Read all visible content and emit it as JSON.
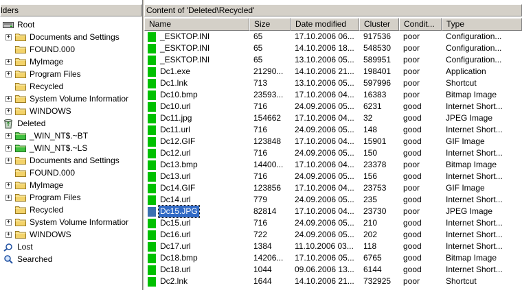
{
  "left_pane": {
    "title": "lders",
    "tree": [
      {
        "label": "Root",
        "icon": "drive-icon",
        "level": 0,
        "expander": "-"
      },
      {
        "label": "Documents and Settings",
        "icon": "folder-icon",
        "level": 1,
        "expander": "+"
      },
      {
        "label": "FOUND.000",
        "icon": "folder-icon",
        "level": 1,
        "expander": ""
      },
      {
        "label": "MyImage",
        "icon": "folder-icon",
        "level": 1,
        "expander": "+"
      },
      {
        "label": "Program Files",
        "icon": "folder-icon",
        "level": 1,
        "expander": "+"
      },
      {
        "label": "Recycled",
        "icon": "folder-icon",
        "level": 1,
        "expander": ""
      },
      {
        "label": "System Volume Informatior",
        "icon": "folder-icon",
        "level": 1,
        "expander": "+"
      },
      {
        "label": "WINDOWS",
        "icon": "folder-icon",
        "level": 1,
        "expander": "+"
      },
      {
        "label": "Deleted",
        "icon": "recycle-bin-icon",
        "level": 0,
        "expander": "-"
      },
      {
        "label": "_WIN_NT$.~BT",
        "icon": "green-folder-icon",
        "level": 1,
        "expander": "+"
      },
      {
        "label": "_WIN_NT$.~LS",
        "icon": "green-folder-icon",
        "level": 1,
        "expander": "+"
      },
      {
        "label": "Documents and Settings",
        "icon": "folder-icon",
        "level": 1,
        "expander": "+"
      },
      {
        "label": "FOUND.000",
        "icon": "folder-icon",
        "level": 1,
        "expander": ""
      },
      {
        "label": "MyImage",
        "icon": "folder-icon",
        "level": 1,
        "expander": "+"
      },
      {
        "label": "Program Files",
        "icon": "folder-icon",
        "level": 1,
        "expander": "+"
      },
      {
        "label": "Recycled",
        "icon": "folder-icon",
        "level": 1,
        "expander": ""
      },
      {
        "label": "System Volume Informatior",
        "icon": "folder-icon",
        "level": 1,
        "expander": "+"
      },
      {
        "label": "WINDOWS",
        "icon": "folder-icon",
        "level": 1,
        "expander": "+"
      },
      {
        "label": "Lost",
        "icon": "lost-search-icon",
        "level": 0,
        "expander": ""
      },
      {
        "label": "Searched",
        "icon": "search-icon",
        "level": 0,
        "expander": ""
      }
    ]
  },
  "right_pane": {
    "title": "Content of 'Deleted\\Recycled'",
    "columns": [
      "Name",
      "Size",
      "Date modified",
      "Cluster",
      "Condit...",
      "Type"
    ],
    "selected_index": 17,
    "rows": [
      [
        "_ESKTOP.INI",
        "65",
        "17.10.2006 06...",
        "917536",
        "poor",
        "Configuration..."
      ],
      [
        "_ESKTOP.INI",
        "65",
        "14.10.2006 18...",
        "548530",
        "poor",
        "Configuration..."
      ],
      [
        "_ESKTOP.INI",
        "65",
        "13.10.2006 05...",
        "589951",
        "poor",
        "Configuration..."
      ],
      [
        "Dc1.exe",
        "21290...",
        "14.10.2006 21...",
        "198401",
        "poor",
        "Application"
      ],
      [
        "Dc1.lnk",
        "713",
        "13.10.2006 05...",
        "597996",
        "poor",
        "Shortcut"
      ],
      [
        "Dc10.bmp",
        "23593...",
        "17.10.2006 04...",
        "16383",
        "poor",
        "Bitmap Image"
      ],
      [
        "Dc10.url",
        "716",
        "24.09.2006 05...",
        "6231",
        "good",
        "Internet Short..."
      ],
      [
        "Dc11.jpg",
        "154662",
        "17.10.2006 04...",
        "32",
        "good",
        "JPEG Image"
      ],
      [
        "Dc11.url",
        "716",
        "24.09.2006 05...",
        "148",
        "good",
        "Internet Short..."
      ],
      [
        "Dc12.GIF",
        "123848",
        "17.10.2006 04...",
        "15901",
        "good",
        "GIF Image"
      ],
      [
        "Dc12.url",
        "716",
        "24.09.2006 05...",
        "150",
        "good",
        "Internet Short..."
      ],
      [
        "Dc13.bmp",
        "14400...",
        "17.10.2006 04...",
        "23378",
        "poor",
        "Bitmap Image"
      ],
      [
        "Dc13.url",
        "716",
        "24.09.2006 05...",
        "156",
        "good",
        "Internet Short..."
      ],
      [
        "Dc14.GIF",
        "123856",
        "17.10.2006 04...",
        "23753",
        "poor",
        "GIF Image"
      ],
      [
        "Dc14.url",
        "779",
        "24.09.2006 05...",
        "235",
        "good",
        "Internet Short..."
      ],
      [
        "Dc15.JPG",
        "82814",
        "17.10.2006 04...",
        "23730",
        "poor",
        "JPEG Image"
      ],
      [
        "Dc15.url",
        "716",
        "24.09.2006 05...",
        "210",
        "good",
        "Internet Short..."
      ],
      [
        "Dc16.url",
        "722",
        "24.09.2006 05...",
        "202",
        "good",
        "Internet Short..."
      ],
      [
        "Dc17.url",
        "1384",
        "11.10.2006 03...",
        "118",
        "good",
        "Internet Short..."
      ],
      [
        "Dc18.bmp",
        "14206...",
        "17.10.2006 05...",
        "6765",
        "good",
        "Bitmap Image"
      ],
      [
        "Dc18.url",
        "1044",
        "09.06.2006 13...",
        "6144",
        "good",
        "Internet Short..."
      ],
      [
        "Dc2.lnk",
        "1644",
        "14.10.2006 21...",
        "732925",
        "poor",
        "Shortcut"
      ]
    ]
  },
  "colors": {
    "file_icon_green": "#00c000",
    "selection_blue": "#316ac5",
    "chrome_gray": "#d4d0c8"
  }
}
